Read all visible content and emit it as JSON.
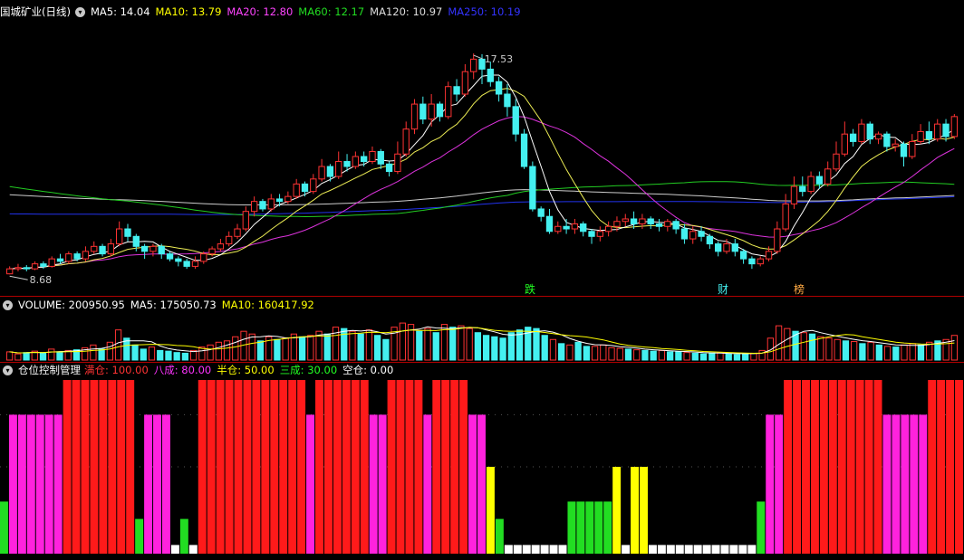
{
  "main_header": {
    "title": "国城矿业(日线)",
    "items": [
      {
        "label": "MA5: 14.04",
        "color": "#ffffff"
      },
      {
        "label": "MA10: 13.79",
        "color": "#ffff00"
      },
      {
        "label": "MA20: 12.80",
        "color": "#ff44ff"
      },
      {
        "label": "MA60: 12.17",
        "color": "#22dd22"
      },
      {
        "label": "MA120: 10.97",
        "color": "#dddddd"
      },
      {
        "label": "MA250: 10.19",
        "color": "#3333ff"
      }
    ]
  },
  "volume_header": {
    "items": [
      {
        "label": "VOLUME: 200950.95",
        "color": "#ffffff"
      },
      {
        "label": "MA5: 175050.73",
        "color": "#ffffff"
      },
      {
        "label": "MA10: 160417.92",
        "color": "#ffff00"
      }
    ]
  },
  "position_header": {
    "title": "仓位控制管理",
    "items": [
      {
        "label": "满仓: 100.00",
        "color": "#ff3333"
      },
      {
        "label": "八成: 80.00",
        "color": "#ff33ff"
      },
      {
        "label": "半仓: 50.00",
        "color": "#ffff00"
      },
      {
        "label": "三成: 30.00",
        "color": "#22ff22"
      },
      {
        "label": "空仓: 0.00",
        "color": "#ffffff"
      }
    ]
  },
  "markers": {
    "fall": "跌",
    "wealth": "财",
    "rank": "榜"
  },
  "colors": {
    "up": "#ff3333",
    "down": "#44f0f0",
    "ma250": "#2233ee",
    "ma120": "#cccccc",
    "ma60": "#22cc22",
    "ma20": "#dd33dd",
    "ma10": "#eeee55",
    "ma5": "#ffffff"
  },
  "chart_data": {
    "type": "candlestick",
    "price_range": [
      8.0,
      18.8
    ],
    "high_label": "17.53",
    "low_label": "8.68",
    "candles": [
      [
        8.7,
        8.9,
        8.68,
        9.0
      ],
      [
        8.9,
        8.95,
        8.8,
        9.1
      ],
      [
        8.95,
        8.9,
        8.8,
        9.05
      ],
      [
        8.9,
        9.1,
        8.85,
        9.2
      ],
      [
        9.1,
        9.0,
        8.9,
        9.2
      ],
      [
        9.0,
        9.3,
        8.95,
        9.4
      ],
      [
        9.3,
        9.2,
        9.1,
        9.5
      ],
      [
        9.2,
        9.5,
        9.1,
        9.6
      ],
      [
        9.5,
        9.3,
        9.2,
        9.6
      ],
      [
        9.3,
        9.6,
        9.2,
        9.8
      ],
      [
        9.6,
        9.8,
        9.5,
        10.0
      ],
      [
        9.8,
        9.5,
        9.4,
        9.9
      ],
      [
        9.5,
        9.9,
        9.4,
        10.1
      ],
      [
        9.9,
        10.5,
        9.8,
        10.8
      ],
      [
        10.5,
        10.2,
        10.0,
        10.7
      ],
      [
        10.2,
        9.8,
        9.6,
        10.3
      ],
      [
        9.8,
        9.6,
        9.3,
        9.9
      ],
      [
        9.6,
        9.8,
        9.4,
        9.9
      ],
      [
        9.8,
        9.5,
        9.3,
        9.9
      ],
      [
        9.5,
        9.3,
        9.2,
        9.6
      ],
      [
        9.3,
        9.2,
        9.0,
        9.4
      ],
      [
        9.2,
        9.0,
        8.9,
        9.3
      ],
      [
        9.0,
        9.2,
        8.9,
        9.4
      ],
      [
        9.2,
        9.5,
        9.1,
        9.6
      ],
      [
        9.5,
        9.7,
        9.4,
        9.8
      ],
      [
        9.7,
        9.9,
        9.6,
        10.1
      ],
      [
        9.9,
        10.2,
        9.8,
        10.4
      ],
      [
        10.2,
        10.5,
        10.1,
        10.7
      ],
      [
        10.5,
        11.2,
        10.4,
        11.4
      ],
      [
        11.2,
        11.6,
        11.0,
        11.8
      ],
      [
        11.6,
        11.3,
        11.2,
        11.7
      ],
      [
        11.3,
        11.7,
        11.2,
        11.9
      ],
      [
        11.7,
        11.6,
        11.4,
        11.9
      ],
      [
        11.6,
        11.8,
        11.5,
        12.0
      ],
      [
        11.8,
        12.3,
        11.7,
        12.5
      ],
      [
        12.3,
        12.0,
        11.8,
        12.4
      ],
      [
        12.0,
        12.5,
        11.9,
        12.7
      ],
      [
        12.5,
        13.0,
        12.4,
        13.3
      ],
      [
        13.0,
        12.6,
        12.4,
        13.1
      ],
      [
        12.6,
        13.2,
        12.5,
        13.6
      ],
      [
        13.2,
        13.0,
        12.8,
        13.5
      ],
      [
        13.0,
        13.4,
        12.9,
        13.6
      ],
      [
        13.4,
        13.2,
        13.0,
        13.6
      ],
      [
        13.2,
        13.6,
        13.1,
        13.8
      ],
      [
        13.6,
        13.1,
        12.9,
        13.7
      ],
      [
        13.1,
        12.8,
        12.6,
        13.2
      ],
      [
        12.8,
        13.5,
        12.7,
        14.0
      ],
      [
        13.5,
        14.5,
        13.4,
        14.8
      ],
      [
        14.5,
        15.5,
        14.3,
        15.7
      ],
      [
        15.5,
        14.9,
        14.7,
        15.8
      ],
      [
        14.9,
        15.5,
        14.6,
        15.9
      ],
      [
        15.5,
        15.0,
        14.8,
        15.6
      ],
      [
        15.0,
        16.2,
        14.9,
        16.4
      ],
      [
        16.2,
        15.9,
        15.6,
        16.5
      ],
      [
        15.9,
        16.8,
        15.8,
        17.1
      ],
      [
        16.8,
        17.3,
        16.5,
        17.53
      ],
      [
        17.3,
        16.9,
        16.3,
        17.5
      ],
      [
        16.9,
        16.4,
        16.2,
        17.2
      ],
      [
        16.4,
        15.9,
        15.6,
        16.6
      ],
      [
        15.9,
        15.4,
        15.0,
        16.3
      ],
      [
        15.4,
        14.3,
        14.0,
        15.7
      ],
      [
        14.3,
        13.0,
        12.9,
        14.5
      ],
      [
        13.0,
        11.3,
        11.2,
        13.2
      ],
      [
        11.3,
        11.0,
        10.8,
        11.4
      ],
      [
        11.0,
        10.4,
        10.3,
        11.3
      ],
      [
        10.4,
        10.6,
        10.3,
        10.8
      ],
      [
        10.6,
        10.5,
        10.3,
        10.9
      ],
      [
        10.5,
        10.7,
        10.3,
        10.9
      ],
      [
        10.7,
        10.4,
        10.2,
        10.8
      ],
      [
        10.4,
        10.2,
        9.9,
        10.5
      ],
      [
        10.2,
        10.4,
        10.0,
        10.6
      ],
      [
        10.4,
        10.6,
        10.2,
        10.8
      ],
      [
        10.6,
        10.8,
        10.4,
        11.0
      ],
      [
        10.8,
        10.9,
        10.6,
        11.1
      ],
      [
        10.9,
        10.7,
        10.5,
        11.2
      ],
      [
        10.7,
        10.9,
        10.5,
        11.1
      ],
      [
        10.9,
        10.7,
        10.5,
        11.0
      ],
      [
        10.7,
        10.6,
        10.4,
        10.9
      ],
      [
        10.6,
        10.8,
        10.4,
        10.9
      ],
      [
        10.8,
        10.5,
        10.3,
        10.9
      ],
      [
        10.5,
        10.1,
        9.9,
        10.7
      ],
      [
        10.1,
        10.4,
        9.9,
        10.6
      ],
      [
        10.4,
        10.2,
        10.0,
        10.6
      ],
      [
        10.2,
        9.9,
        9.7,
        10.3
      ],
      [
        9.9,
        9.6,
        9.4,
        10.0
      ],
      [
        9.6,
        9.9,
        9.5,
        10.1
      ],
      [
        9.9,
        9.6,
        9.4,
        10.1
      ],
      [
        9.6,
        9.3,
        9.1,
        9.7
      ],
      [
        9.3,
        9.1,
        8.9,
        9.4
      ],
      [
        9.1,
        9.3,
        9.0,
        9.4
      ],
      [
        9.3,
        9.6,
        9.2,
        9.8
      ],
      [
        9.6,
        10.5,
        9.5,
        10.8
      ],
      [
        10.5,
        11.5,
        10.4,
        11.9
      ],
      [
        11.5,
        12.2,
        11.3,
        12.6
      ],
      [
        12.2,
        12.0,
        11.8,
        12.6
      ],
      [
        12.0,
        12.6,
        11.9,
        12.8
      ],
      [
        12.6,
        12.3,
        12.1,
        12.8
      ],
      [
        12.3,
        12.9,
        12.2,
        13.2
      ],
      [
        12.9,
        13.5,
        12.8,
        14.0
      ],
      [
        13.5,
        14.3,
        13.4,
        14.8
      ],
      [
        14.3,
        14.0,
        13.8,
        14.5
      ],
      [
        14.0,
        14.7,
        13.9,
        14.9
      ],
      [
        14.7,
        14.1,
        13.9,
        14.8
      ],
      [
        14.1,
        14.3,
        13.9,
        14.4
      ],
      [
        14.3,
        13.8,
        13.6,
        14.4
      ],
      [
        13.8,
        13.9,
        13.6,
        14.1
      ],
      [
        13.9,
        13.4,
        13.0,
        14.0
      ],
      [
        13.4,
        14.0,
        13.3,
        14.3
      ],
      [
        14.0,
        14.4,
        13.9,
        14.7
      ],
      [
        14.4,
        14.1,
        13.9,
        14.8
      ],
      [
        14.1,
        14.7,
        14.0,
        14.9
      ],
      [
        14.7,
        14.2,
        14.0,
        14.9
      ],
      [
        14.2,
        15.0,
        14.1,
        15.1
      ]
    ],
    "volume_range": [
      0,
      330000
    ],
    "volumes": [
      60,
      45,
      55,
      65,
      50,
      80,
      60,
      70,
      75,
      90,
      110,
      80,
      130,
      220,
      160,
      110,
      80,
      95,
      70,
      65,
      55,
      50,
      70,
      95,
      110,
      130,
      140,
      170,
      210,
      190,
      140,
      170,
      150,
      160,
      190,
      170,
      180,
      210,
      190,
      240,
      230,
      210,
      190,
      220,
      180,
      150,
      240,
      270,
      260,
      210,
      230,
      200,
      260,
      240,
      250,
      230,
      200,
      180,
      170,
      160,
      200,
      220,
      240,
      230,
      180,
      150,
      120,
      110,
      130,
      100,
      100,
      110,
      90,
      85,
      80,
      75,
      70,
      65,
      70,
      60,
      60,
      55,
      50,
      45,
      50,
      55,
      45,
      40,
      45,
      50,
      70,
      160,
      250,
      230,
      210,
      200,
      190,
      170,
      160,
      150,
      140,
      135,
      120,
      130,
      110,
      100,
      95,
      110,
      120,
      110,
      130,
      140,
      150,
      180
    ],
    "position_range": [
      0,
      100
    ],
    "positions": [
      30,
      80,
      80,
      80,
      80,
      80,
      80,
      100,
      100,
      100,
      100,
      100,
      100,
      100,
      100,
      20,
      80,
      80,
      80,
      0,
      20,
      0,
      100,
      100,
      100,
      100,
      100,
      100,
      100,
      100,
      100,
      100,
      100,
      100,
      80,
      100,
      100,
      100,
      100,
      100,
      100,
      80,
      80,
      100,
      100,
      100,
      100,
      80,
      100,
      100,
      100,
      100,
      80,
      80,
      50,
      20,
      0,
      0,
      0,
      0,
      0,
      0,
      0,
      30,
      30,
      30,
      30,
      30,
      50,
      0,
      50,
      50,
      0,
      0,
      0,
      0,
      0,
      0,
      0,
      0,
      0,
      0,
      0,
      0,
      30,
      80,
      80,
      100,
      100,
      100,
      100,
      100,
      100,
      100,
      100,
      100,
      100,
      100,
      80,
      80,
      80,
      80,
      80,
      100,
      100,
      100,
      100
    ]
  }
}
